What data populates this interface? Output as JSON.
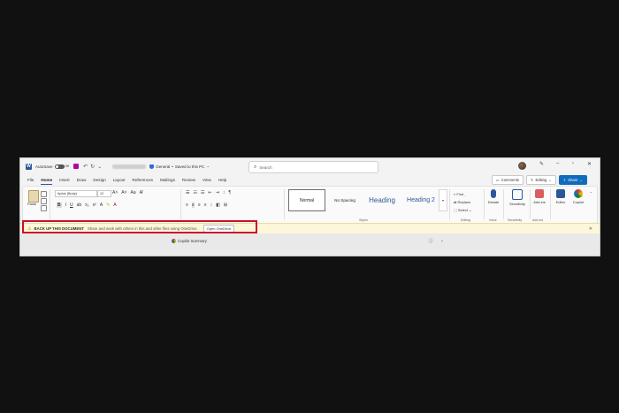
{
  "titlebar": {
    "autosave_label": "AutoSave",
    "autosave_state": "Off",
    "sensitivity_label": "General",
    "save_status": "Saved to this PC",
    "search_placeholder": "Search"
  },
  "tabs": [
    "File",
    "Home",
    "Insert",
    "Draw",
    "Design",
    "Layout",
    "References",
    "Mailings",
    "Review",
    "View",
    "Help"
  ],
  "active_tab": "Home",
  "right_buttons": {
    "comments": "Comments",
    "editing": "Editing",
    "share": "Share"
  },
  "ribbon": {
    "paste": "Paste",
    "font_name": "Aptos (Body)",
    "font_size": "12",
    "styles": [
      "Normal",
      "No Spacing",
      "Heading",
      "Heading 2"
    ],
    "styles_group": "Styles",
    "editing": {
      "find": "Find",
      "replace": "Replace",
      "select": "Select",
      "group": "Editing"
    },
    "voice": {
      "label": "Dictate",
      "group": "Voice"
    },
    "sensitivity": {
      "label": "Sensitivity",
      "group": "Sensitivity"
    },
    "addins": {
      "label": "Add-ins",
      "group": "Add-ins"
    },
    "editor": "Editor",
    "copilot": "Copilot"
  },
  "notification": {
    "title": "BACK UP THIS DOCUMENT",
    "message": "Share and work with others in this and other files using OneDrive.",
    "button": "Open OneDrive"
  },
  "copilot_summary": "Copilot Summary",
  "colors": {
    "brand": "#2b579a",
    "share": "#0f6cbd",
    "highlight_frame": "#c8102e",
    "notification_bg": "#fdf6d8"
  }
}
